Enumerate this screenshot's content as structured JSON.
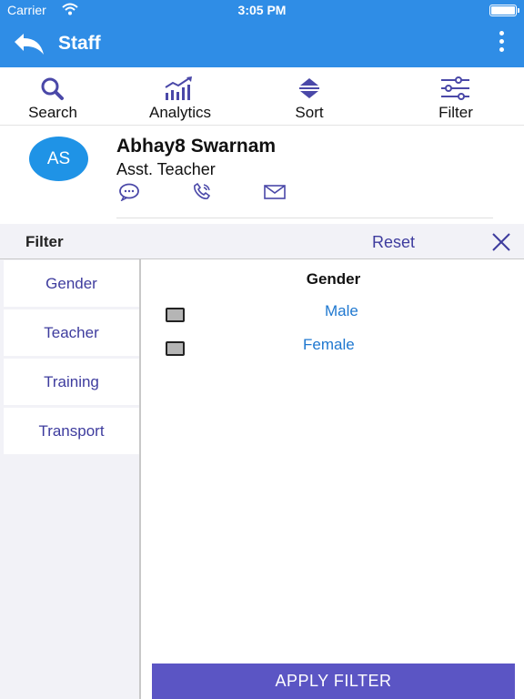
{
  "status_bar": {
    "carrier": "Carrier",
    "time": "3:05 PM",
    "wifi_icon": "wifi-icon",
    "battery_icon": "battery-icon"
  },
  "app_bar": {
    "title": "Staff",
    "back_icon": "back-arrow-icon",
    "menu_icon": "more-vertical-icon"
  },
  "toolbar": {
    "items": [
      {
        "label": "Search",
        "icon": "search-icon"
      },
      {
        "label": "Analytics",
        "icon": "analytics-icon"
      },
      {
        "label": "Sort",
        "icon": "sort-icon"
      },
      {
        "label": "Filter",
        "icon": "filter-sliders-icon"
      }
    ]
  },
  "staff": {
    "initials": "AS",
    "name": "Abhay8 Swarnam",
    "role": "Asst. Teacher",
    "contact_icons": [
      "message-icon",
      "phone-icon",
      "mail-icon"
    ]
  },
  "filter": {
    "title": "Filter",
    "reset_label": "Reset",
    "close_icon": "close-icon",
    "categories": [
      "Gender",
      "Teacher",
      "Training",
      "Transport"
    ],
    "active_heading": "Gender",
    "options": [
      {
        "label": "Male",
        "checked": false
      },
      {
        "label": "Female",
        "checked": false
      }
    ],
    "apply_label": "APPLY FILTER"
  },
  "colors": {
    "primary": "#2f8de6",
    "accent": "#5b55c4",
    "link": "#3e3c9e",
    "option_text": "#1f78d0"
  }
}
